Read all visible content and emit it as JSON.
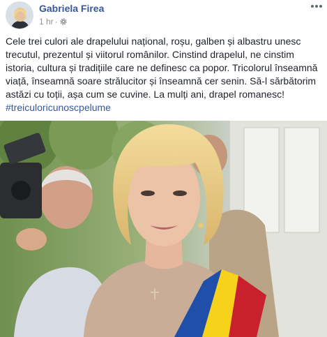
{
  "post": {
    "author_name": "Gabriela Firea",
    "timestamp": "1 hr",
    "separator": "·",
    "audience_icon": "gear-icon",
    "more_icon": "ellipsis-icon",
    "text": "Cele trei culori ale drapelului național, roșu, galben și albastru unesc trecutul, prezentul și viitorul românilor. Cinstind drapelul, ne cinstim istoria, cultura și tradițiile care ne definesc ca popor. Tricolorul înseamnă viață, înseamnă soare strălucitor și înseamnă cer senin. Să-l sărbătorim astăzi cu toții, așa cum se cuvine. La mulți ani, drapel romanesc!",
    "hashtag": "#treiculoricunoscpelume"
  },
  "colors": {
    "link": "#365899",
    "text": "#1d2129",
    "meta": "#90949c",
    "sash_blue": "#1f4fa8",
    "sash_yellow": "#f6d21a",
    "sash_red": "#c8202c"
  }
}
